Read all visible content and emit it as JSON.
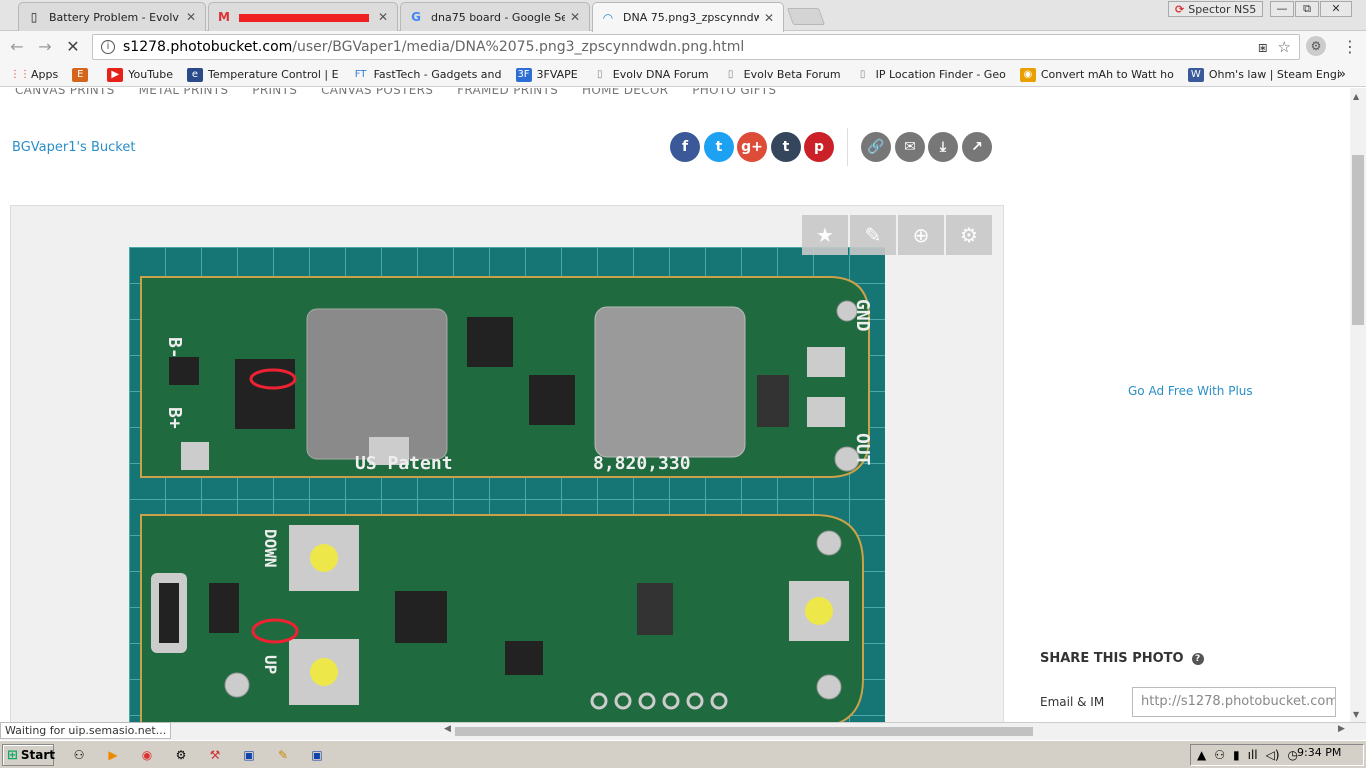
{
  "tabs": [
    {
      "title": "Battery Problem - Evolv DNA",
      "icon": "page-icon",
      "active": false
    },
    {
      "title": "",
      "icon": "gmail-icon",
      "active": false
    },
    {
      "title": "dna75 board - Google Search",
      "icon": "google-icon",
      "active": false
    },
    {
      "title": "DNA 75.png3_zpscynndwdn",
      "icon": "loading-icon",
      "active": true
    }
  ],
  "window": {
    "profile": "Spector NS5",
    "minimize": "—",
    "restore": "⧉",
    "close": "✕"
  },
  "toolbar": {
    "url_host": "s1278.photobucket.com",
    "url_path": "/user/BGVaper1/media/DNA%2075.png3_zpscynndwdn.png.html"
  },
  "bookmarks": [
    {
      "label": "Apps",
      "icon": "apps-icon",
      "color": "#e44"
    },
    {
      "label": "",
      "icon": "etsy-icon",
      "color": "#d5641c"
    },
    {
      "label": "YouTube",
      "icon": "youtube-icon",
      "color": "#e62117"
    },
    {
      "label": "Temperature Control | E",
      "icon": "ecf-icon",
      "color": "#2a4a8a"
    },
    {
      "label": "FastTech - Gadgets and",
      "icon": "fasttech-icon",
      "color": "#3a7bd5"
    },
    {
      "label": "3FVAPE",
      "icon": "3fvape-icon",
      "color": "#2c6ed3"
    },
    {
      "label": "Evolv DNA Forum",
      "icon": "page-icon",
      "color": "#888"
    },
    {
      "label": "Evolv Beta Forum",
      "icon": "page-icon",
      "color": "#888"
    },
    {
      "label": "IP Location Finder - Geo",
      "icon": "page-icon",
      "color": "#888"
    },
    {
      "label": "Convert mAh to Watt ho",
      "icon": "chrome-icon",
      "color": "#e8a000"
    },
    {
      "label": "Ohm's law | Steam Engi",
      "icon": "steam-icon",
      "color": "#3a5a9a"
    }
  ],
  "page": {
    "nav": [
      "CANVAS PRINTS",
      "METAL PRINTS",
      "PRINTS",
      "CANVAS POSTERS",
      "FRAMED PRINTS",
      "HOME DECOR",
      "PHOTO GIFTS"
    ],
    "bucket_link": "BGVaper1's Bucket",
    "share_buttons": [
      {
        "name": "facebook",
        "glyph": "f",
        "color": "#3b5998"
      },
      {
        "name": "twitter",
        "glyph": "t",
        "color": "#1da1f2"
      },
      {
        "name": "googleplus",
        "glyph": "g+",
        "color": "#dd4b39"
      },
      {
        "name": "tumblr",
        "glyph": "t",
        "color": "#35465c"
      },
      {
        "name": "pinterest",
        "glyph": "p",
        "color": "#cb2027"
      },
      {
        "name": "link",
        "glyph": "🔗",
        "color": "#777"
      },
      {
        "name": "email",
        "glyph": "✉",
        "color": "#777"
      },
      {
        "name": "download",
        "glyph": "⤓",
        "color": "#777"
      },
      {
        "name": "share",
        "glyph": "↗",
        "color": "#777"
      }
    ],
    "viewer_tools": [
      "★",
      "✎",
      "⊕",
      "⚙"
    ],
    "board_labels": {
      "b_minus": "B-",
      "b_plus": "B+",
      "gnd": "GND",
      "out": "OUT",
      "patent_left": "US Patent",
      "patent_right": "8,820,330",
      "down": "DOWN",
      "up": "UP"
    },
    "ad_free": "Go Ad Free With Plus",
    "share_title": "SHARE THIS PHOTO",
    "share_help": "?",
    "email_label": "Email & IM",
    "email_value": "http://s1278.photobucket.com"
  },
  "status": {
    "loading": "Waiting for uip.semasio.net..."
  },
  "taskbar": {
    "start": "Start",
    "clock": "9:34 PM"
  }
}
